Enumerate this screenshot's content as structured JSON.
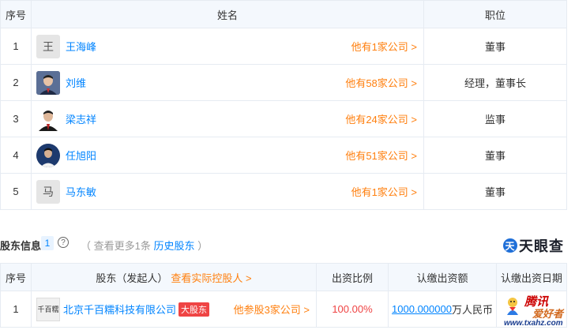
{
  "staff_table": {
    "headers": {
      "index": "序号",
      "name": "姓名",
      "position": "职位"
    },
    "rows": [
      {
        "index": "1",
        "avatar_char": "王",
        "name": "王海峰",
        "more": "他有1家公司 >",
        "position": "董事"
      },
      {
        "index": "2",
        "avatar_char": "",
        "name": "刘维",
        "more": "他有58家公司 >",
        "position": "经理，董事长"
      },
      {
        "index": "3",
        "avatar_char": "",
        "name": "梁志祥",
        "more": "他有24家公司 >",
        "position": "监事"
      },
      {
        "index": "4",
        "avatar_char": "",
        "name": "任旭阳",
        "more": "他有51家公司 >",
        "position": "董事"
      },
      {
        "index": "5",
        "avatar_char": "马",
        "name": "马东敏",
        "more": "他有1家公司 >",
        "position": "董事"
      }
    ]
  },
  "shareholder_section": {
    "title": "股东信息",
    "count": "1",
    "help": "?",
    "more_prefix": "（ 查看更多1条",
    "history_link": "历史股东",
    "more_suffix": "）",
    "logo_mark": "天",
    "logo_text": "天眼查"
  },
  "shareholder_table": {
    "headers": {
      "index": "序号",
      "holder": "股东（发起人）",
      "holder_link": "查看实际控股人 >",
      "ratio": "出资比例",
      "amount": "认缴出资额",
      "date": "认缴出资日期"
    },
    "rows": [
      {
        "index": "1",
        "logo_text": "千百糯",
        "name": "北京千百糯科技有限公司",
        "tag": "大股东",
        "more": "他参股3家公司 >",
        "ratio": "100.00%",
        "amount": "1000.000000",
        "amount_unit": "万人民币",
        "date": ""
      }
    ]
  },
  "watermark": {
    "line1": "腾讯",
    "line2": "爱好者",
    "line3": "www.txahz.com"
  }
}
